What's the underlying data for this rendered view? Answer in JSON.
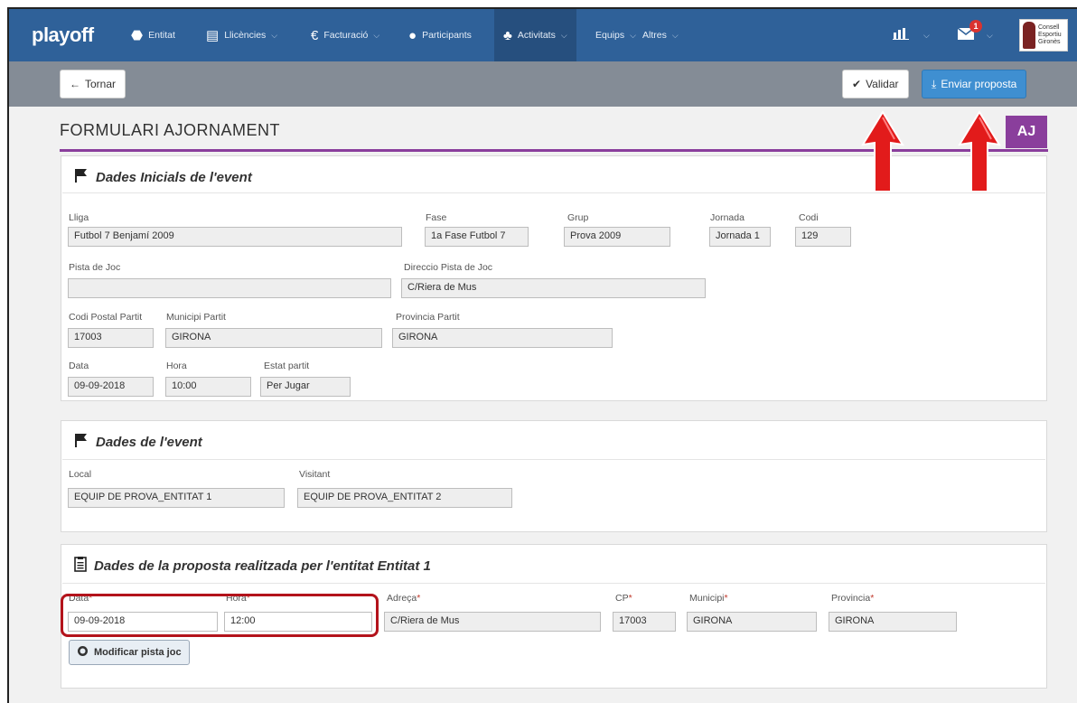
{
  "nav": {
    "brand": "playoff",
    "items": [
      {
        "label": "Entitat",
        "caret": false
      },
      {
        "label": "Llicències",
        "caret": true
      },
      {
        "label": "Facturació",
        "caret": true
      },
      {
        "label": "Participants",
        "caret": false
      },
      {
        "label": "Activitats",
        "caret": true,
        "active": true
      },
      {
        "label": "Equips",
        "caret": true
      },
      {
        "label": "Altres",
        "caret": true
      }
    ],
    "mail_badge": "1",
    "logo_text": [
      "Consell",
      "Esportiu",
      "Gironès"
    ]
  },
  "actions": {
    "back_label": "Tornar",
    "validate_label": "Validar",
    "send_label": "Enviar proposta"
  },
  "page": {
    "title": "FORMULARI AJORNAMENT",
    "badge": "AJ"
  },
  "initial": {
    "title": "Dades Inicials de l'event",
    "lliga_label": "Lliga",
    "lliga": "Futbol 7 Benjamí 2009",
    "fase_label": "Fase",
    "fase": "1a Fase  Futbol 7",
    "grup_label": "Grup",
    "grup": "Prova 2009",
    "jornada_label": "Jornada",
    "jornada": "Jornada 1",
    "codi_label": "Codi",
    "codi": "129",
    "pista_label": "Pista de Joc",
    "pista": "",
    "direccio_label": "Direccio Pista de Joc",
    "direccio": "C/Riera de Mus",
    "cp_label": "Codi Postal Partit",
    "cp": "17003",
    "municipi_label": "Municipi Partit",
    "municipi": "GIRONA",
    "provincia_label": "Provincia Partit",
    "provincia": "GIRONA",
    "data_label": "Data",
    "data": "09-09-2018",
    "hora_label": "Hora",
    "hora": "10:00",
    "estat_label": "Estat partit",
    "estat": "Per Jugar"
  },
  "event": {
    "title": "Dades de l'event",
    "local_label": "Local",
    "local": "EQUIP DE PROVA_ENTITAT 1",
    "visitant_label": "Visitant",
    "visitant": "EQUIP DE PROVA_ENTITAT 2"
  },
  "proposal": {
    "title": "Dades de la proposta realitzada per l'entitat Entitat 1",
    "data_label": "Data",
    "data": "09-09-2018",
    "hora_label": "Hora",
    "hora": "12:00",
    "adreca_label": "Adreça",
    "adreca": "C/Riera de Mus",
    "cp_label": "CP",
    "cp": "17003",
    "municipi_label": "Municipi",
    "municipi": "GIRONA",
    "provincia_label": "Provincia",
    "provincia": "GIRONA",
    "required_mark": "*",
    "modify_label": "Modificar pista joc"
  },
  "colors": {
    "nav": "#2f6199",
    "action_bar": "#848c96",
    "accent_purple": "#8a3e9c",
    "highlight_red": "#b3131b",
    "primary_button": "#3f8fd1"
  }
}
